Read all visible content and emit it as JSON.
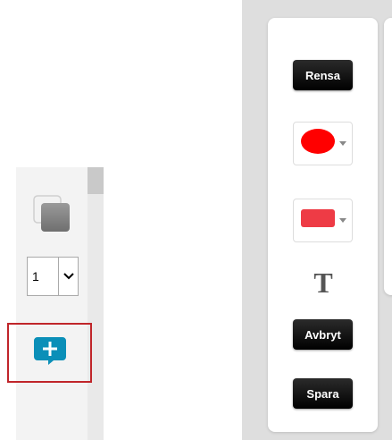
{
  "left_panel": {
    "page_select": {
      "value": "1",
      "options": [
        "1"
      ]
    },
    "icons": {
      "layers": "layers-icon",
      "add": "add-comment-icon"
    }
  },
  "toolbar": {
    "clear_label": "Rensa",
    "cancel_label": "Avbryt",
    "save_label": "Spara",
    "text_tool_label": "T",
    "fill_color": "#ff0000",
    "stroke_color": "#ee3b45"
  },
  "colors": {
    "highlight_border": "#c0252a",
    "add_icon": "#0a8fb8"
  }
}
